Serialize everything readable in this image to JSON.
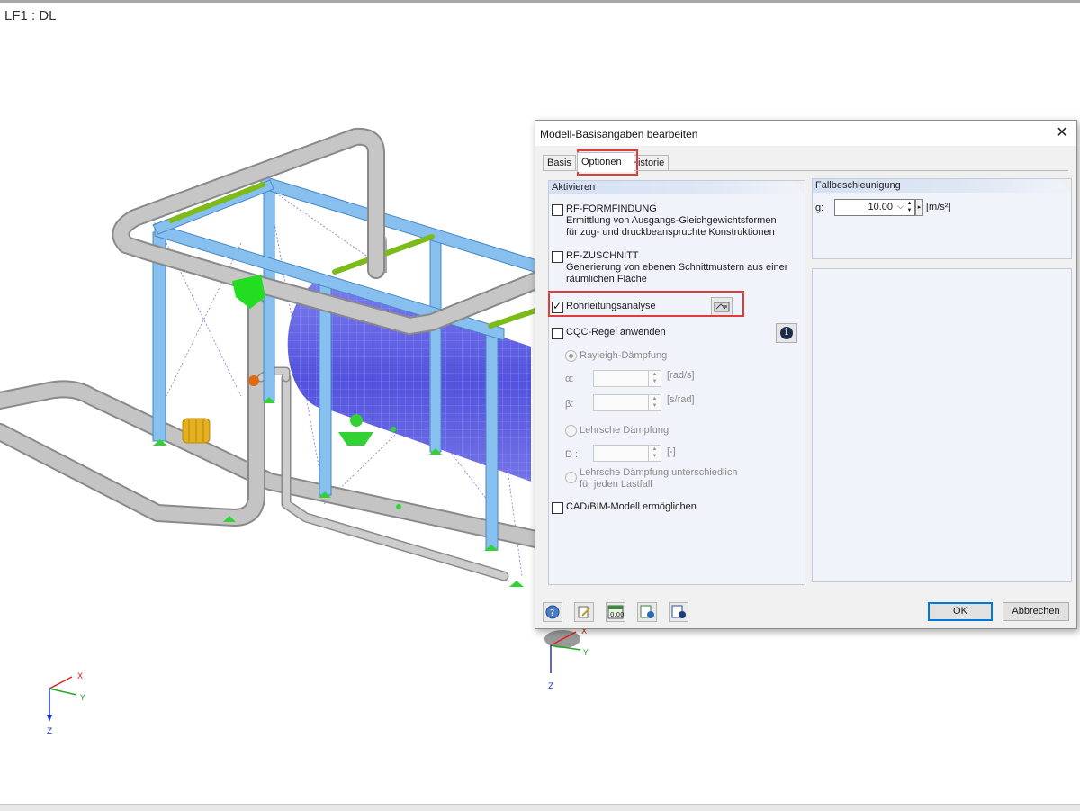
{
  "viewport": {
    "load_case_label": "LF1 : DL"
  },
  "axes": {
    "x": "X",
    "y": "Y",
    "z": "Z"
  },
  "dialog": {
    "title": "Modell-Basisangaben bearbeiten",
    "close": "✕",
    "tabs": [
      {
        "label": "Basis",
        "active": false
      },
      {
        "label": "Optionen",
        "active": true
      },
      {
        "label": "Historie",
        "active": false
      }
    ],
    "activate": {
      "header": "Aktivieren",
      "formfinding": {
        "label": "RF-FORMFINDUNG",
        "line1": "Ermittlung von Ausgangs-Gleichgewichtsformen",
        "line2": "für zug- und druckbeanspruchte Konstruktionen",
        "checked": false
      },
      "cutting": {
        "label": "RF-ZUSCHNITT",
        "line1": "Generierung von ebenen Schnittmustern aus einer",
        "line2": "räumlichen Fläche",
        "checked": false
      },
      "piping": {
        "label": "Rohrleitungsanalyse",
        "checked": true
      },
      "cqc": {
        "label": "CQC-Regel anwenden",
        "checked": false
      },
      "rayleigh": "Rayleigh-Dämpfung",
      "alpha_label": "α:",
      "alpha_unit": "[rad/s]",
      "beta_label": "β:",
      "beta_unit": "[s/rad]",
      "lehr": "Lehrsche Dämpfung",
      "d_label": "D :",
      "d_unit": "[-]",
      "lehr_diff_1": "Lehrsche Dämpfung unterschiedlich",
      "lehr_diff_2": "für jeden Lastfall",
      "cad": {
        "label": "CAD/BIM-Modell ermöglichen",
        "checked": false
      }
    },
    "gravity": {
      "header": "Fallbeschleunigung",
      "label": "g:",
      "value": "10.00",
      "unit": "[m/s²]"
    },
    "buttons": {
      "ok": "OK",
      "cancel": "Abbrechen"
    }
  },
  "colors": {
    "steel": "#87c0ee",
    "vessel": "#6b6be6",
    "pipe": "#b4b4b4",
    "highlight": "#e03c3c",
    "support": "#33d133"
  }
}
